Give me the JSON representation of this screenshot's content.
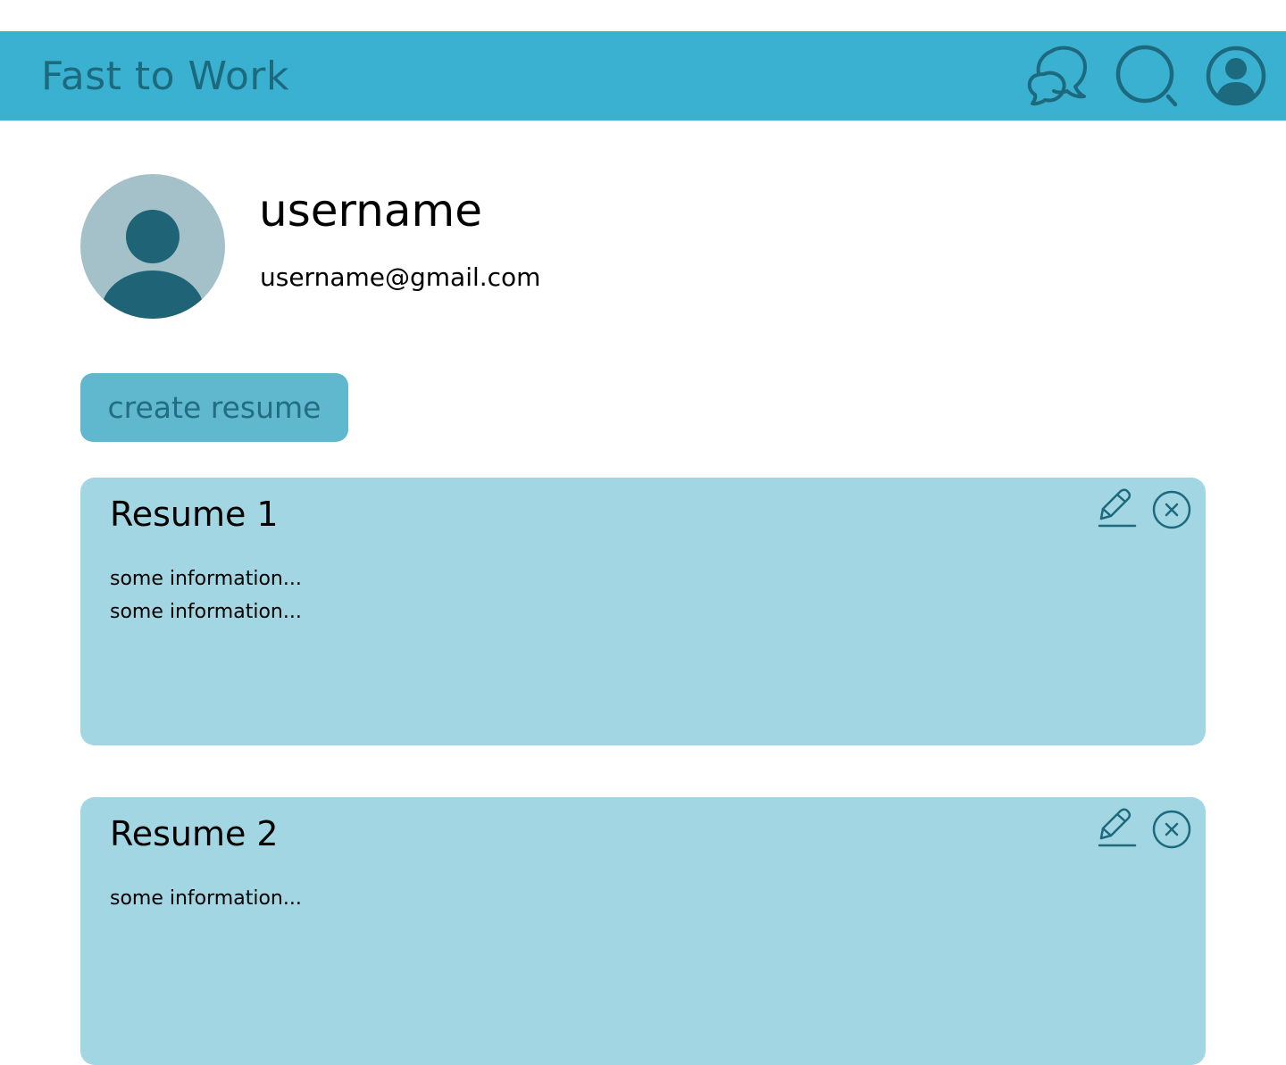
{
  "header": {
    "title": "Fast to Work",
    "icons": [
      "chat-icon",
      "search-icon",
      "profile-icon"
    ],
    "background": "#3ab1d1",
    "title_color": "#1d6a7e"
  },
  "profile": {
    "avatar_icon": "user-avatar-icon",
    "username": "username",
    "email": "username@gmail.com"
  },
  "actions": {
    "create_resume_label": "create resume"
  },
  "resumes": [
    {
      "title": "Resume 1",
      "info": [
        "some information...",
        "some information..."
      ]
    },
    {
      "title": "Resume 2",
      "info": [
        "some information..."
      ]
    }
  ],
  "colors": {
    "card_background": "#a1d6e2",
    "button_background": "#5fb8ce",
    "icon_dark": "#1d6a7e",
    "avatar_background": "#a4c1c9"
  }
}
